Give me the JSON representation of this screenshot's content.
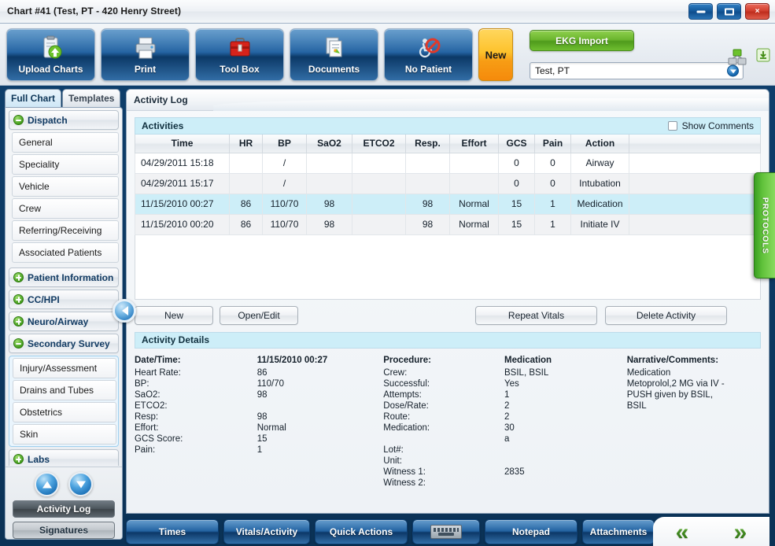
{
  "window": {
    "title": "Chart #41 (Test, PT - 420 Henry Street)",
    "minimize_label": "",
    "maximize_label": "",
    "close_label": "×"
  },
  "toolbar": {
    "buttons": [
      {
        "label": "Upload Charts",
        "icon": "clipboard-upload-icon"
      },
      {
        "label": "Print",
        "icon": "printer-icon"
      },
      {
        "label": "Tool Box",
        "icon": "toolbox-icon"
      },
      {
        "label": "Documents",
        "icon": "documents-icon"
      },
      {
        "label": "No Patient",
        "icon": "no-patient-icon"
      }
    ],
    "new_label": "New",
    "ekg_label": "EKG Import",
    "patient_value": "Test, PT",
    "sync_icon": "network-sync-icon",
    "download_icon": "download-icon"
  },
  "sidebar": {
    "tabs": [
      {
        "label": "Full Chart",
        "active": true
      },
      {
        "label": "Templates",
        "active": false
      }
    ],
    "groups": [
      {
        "label": "Dispatch",
        "expanded": true,
        "items": [
          "General",
          "Speciality",
          "Vehicle",
          "Crew",
          "Referring/Receiving",
          "Associated Patients"
        ]
      },
      {
        "label": "Patient Information",
        "expanded": false,
        "items": []
      },
      {
        "label": "CC/HPI",
        "expanded": false,
        "items": []
      },
      {
        "label": "Neuro/Airway",
        "expanded": false,
        "items": []
      },
      {
        "label": "Secondary Survey",
        "expanded": true,
        "items": [
          "Injury/Assessment",
          "Drains and Tubes",
          "Obstetrics",
          "Skin"
        ]
      },
      {
        "label": "Labs",
        "expanded": false,
        "items": []
      }
    ],
    "scroll_up_icon": "arrow-up-icon",
    "scroll_down_icon": "arrow-down-icon",
    "activity_log_label": "Activity Log",
    "signatures_label": "Signatures",
    "collapse_icon": "collapse-left-icon"
  },
  "content": {
    "header": "Activity Log",
    "activities_panel": {
      "title": "Activities",
      "show_comments_label": "Show Comments",
      "show_comments_checked": false,
      "columns": [
        "Time",
        "HR",
        "BP",
        "SaO2",
        "ETCO2",
        "Resp.",
        "Effort",
        "GCS",
        "Pain",
        "Action",
        ""
      ],
      "rows": [
        {
          "selected": false,
          "cells": [
            "04/29/2011 15:18",
            "",
            "/",
            "",
            "",
            "",
            "",
            "0",
            "0",
            "Airway",
            ""
          ]
        },
        {
          "selected": false,
          "cells": [
            "04/29/2011 15:17",
            "",
            "/",
            "",
            "",
            "",
            "",
            "0",
            "0",
            "Intubation",
            ""
          ]
        },
        {
          "selected": true,
          "cells": [
            "11/15/2010 00:27",
            "86",
            "110/70",
            "98",
            "",
            "98",
            "Normal",
            "15",
            "1",
            "Medication",
            ""
          ]
        },
        {
          "selected": false,
          "cells": [
            "11/15/2010 00:20",
            "86",
            "110/70",
            "98",
            "",
            "98",
            "Normal",
            "15",
            "1",
            "Initiate IV",
            ""
          ]
        }
      ]
    },
    "action_buttons": {
      "new": "New",
      "open_edit": "Open/Edit",
      "repeat_vitals": "Repeat Vitals",
      "delete_activity": "Delete Activity"
    },
    "details": {
      "title": "Activity Details",
      "col1_labels": [
        "Date/Time:",
        "Heart Rate:",
        "BP:",
        "SaO2:",
        "ETCO2:",
        "Resp:",
        "Effort:",
        "GCS Score:",
        "Pain:"
      ],
      "col2_values": [
        "11/15/2010 00:27",
        "86",
        "110/70",
        "98",
        "",
        "98",
        "Normal",
        "15",
        "1"
      ],
      "col3_labels": [
        "Procedure:",
        "Crew:",
        "Successful:",
        "Attempts:",
        "Dose/Rate:",
        "Route:",
        "Medication:",
        "",
        "Lot#:",
        "Unit:",
        "Witness 1:",
        "Witness 2:"
      ],
      "col4_header": "Medication",
      "col4_values": [
        "BSIL, BSIL",
        "Yes",
        "1",
        "2",
        "2",
        "30",
        "a",
        "",
        "",
        "2835",
        "",
        ""
      ],
      "col5_header": "Narrative/Comments:",
      "col5_text": "Medication\nMetoprolol,2 MG via IV -\nPUSH given by BSIL,\nBSIL"
    }
  },
  "protocols_tab": {
    "label": "PROTOCOLS"
  },
  "bottom_nav": {
    "buttons": [
      {
        "label": "Times",
        "icon": ""
      },
      {
        "label": "Vitals/Activity",
        "icon": ""
      },
      {
        "label": "Quick Actions",
        "icon": ""
      },
      {
        "label": "",
        "icon": "keyboard-icon"
      },
      {
        "label": "Notepad",
        "icon": ""
      },
      {
        "label": "Attachments",
        "icon": ""
      }
    ],
    "prev_icon": "«",
    "next_icon": "»"
  },
  "colors": {
    "accent_blue": "#1b5d9e",
    "panel_cyan": "#cdeef8",
    "green": "#62c33c",
    "orange": "#f79d15",
    "frame_blue": "#0e3e6b"
  }
}
